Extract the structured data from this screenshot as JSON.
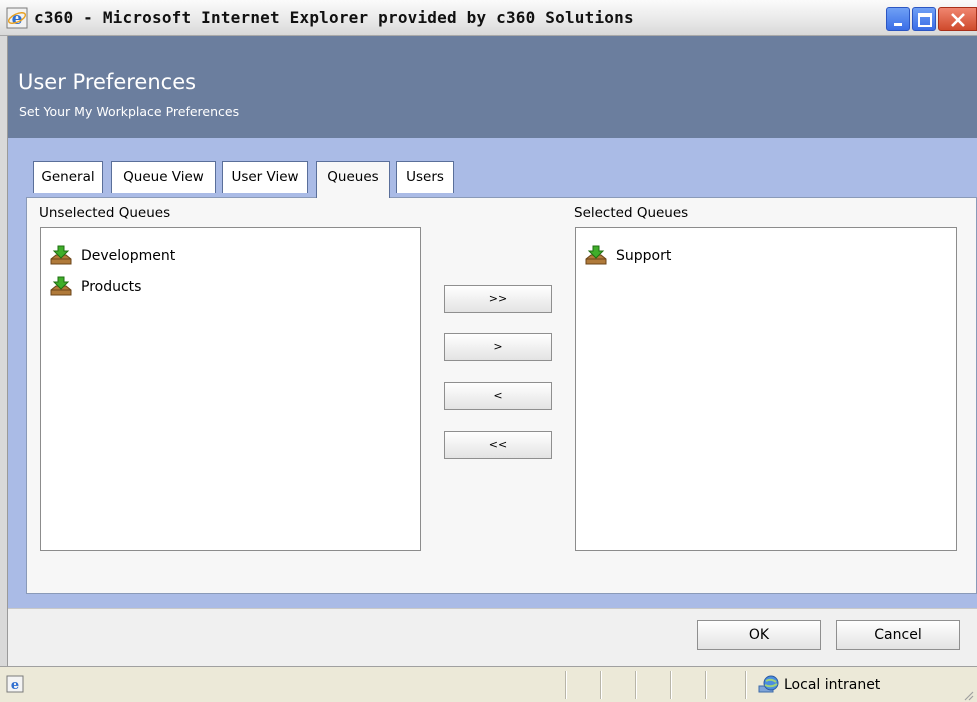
{
  "window": {
    "title": "c360 - Microsoft Internet Explorer provided by c360 Solutions"
  },
  "header": {
    "title": "User Preferences",
    "subtitle": "Set Your My Workplace Preferences"
  },
  "tabs": [
    {
      "label": "General",
      "active": false
    },
    {
      "label": "Queue View",
      "active": false
    },
    {
      "label": "User View",
      "active": false
    },
    {
      "label": "Queues",
      "active": true
    },
    {
      "label": "Users",
      "active": false
    }
  ],
  "unselected": {
    "label": "Unselected Queues",
    "items": [
      "Development",
      "Products"
    ]
  },
  "selected": {
    "label": "Selected Queues",
    "items": [
      "Support"
    ]
  },
  "move_buttons": {
    "add_all": ">>",
    "add": ">",
    "remove": "<",
    "remove_all": "<<"
  },
  "footer": {
    "ok_label": "OK",
    "cancel_label": "Cancel"
  },
  "statusbar": {
    "zone_label": "Local intranet"
  },
  "icons": {
    "app": "ie-icon",
    "queue": "queue-inbox-icon",
    "zone": "globe-icon"
  },
  "colors": {
    "header_bg": "#6b7e9e",
    "content_bg": "#aabbe6",
    "close_button": "#cf4a2c",
    "window_buttons": "#3a6de6"
  }
}
